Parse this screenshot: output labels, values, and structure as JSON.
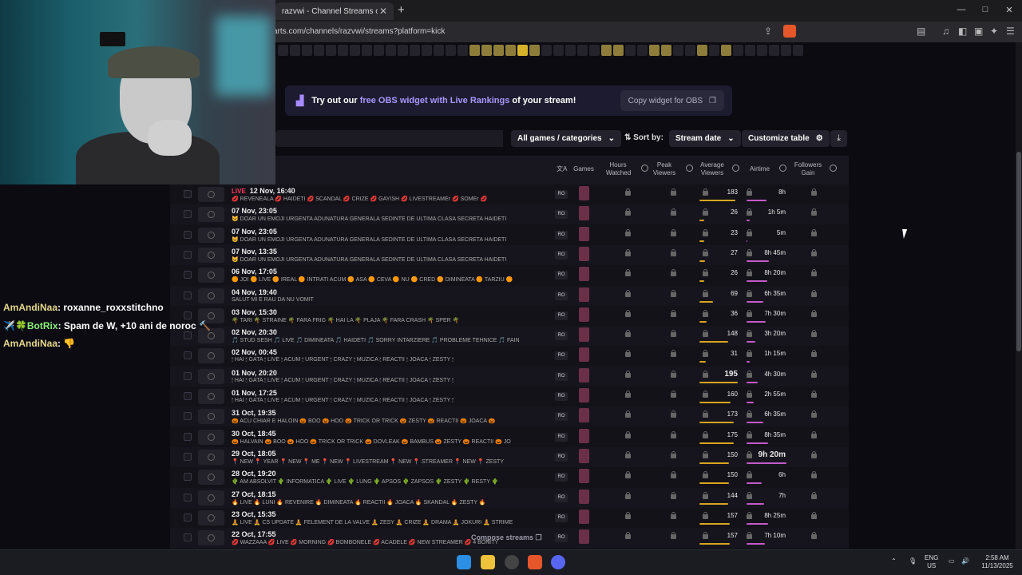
{
  "browser": {
    "tab_title": "razvwi - Channel Streams on Kick",
    "url": "arts.com/channels/razvwi/streams?platform=kick",
    "window_controls": [
      "—",
      "□",
      "✕"
    ]
  },
  "banner": {
    "prefix": "Try out our",
    "highlight": "free OBS widget with Live Rankings",
    "suffix": "of your stream!",
    "copy_label": "Copy widget for OBS"
  },
  "toolbar": {
    "games_filter": "All games / categories",
    "sort_label": "Sort by:",
    "sort_value": "Stream date",
    "customize_label": "Customize table"
  },
  "table": {
    "headers": {
      "stream": "e",
      "games": "Games",
      "hours_watched": "Hours Watched",
      "peak_viewers": "Peak Viewers",
      "average_viewers": "Average Viewers",
      "airtime": "Airtime",
      "followers_gain": "Followers Gain"
    },
    "live_badge": "LIVE",
    "rows": [
      {
        "date": "12 Nov, 16:40",
        "title": "💋 REVENEALA 💋 HAIDETI 💋 SCANDAL 💋 CRIZE 💋 GAYISH 💋 LIVESTREAMEr 💋 SOMEr 💋",
        "lang": "RO",
        "avg": "183",
        "avg_frac": 0.94,
        "airtime": "8h",
        "air_frac": 0.5,
        "live": true
      },
      {
        "date": "07 Nov, 23:05",
        "title": "😺 DOAR UN EMOJI URGENTA ADUNATURA GENERALA SEDINTE DE ULTIMA CLASA SECRETA HAIDETI",
        "lang": "RO",
        "avg": "26",
        "avg_frac": 0.13,
        "airtime": "1h 5m",
        "air_frac": 0.07
      },
      {
        "date": "07 Nov, 23:05",
        "title": "😺 DOAR UN EMOJI URGENTA ADUNATURA GENERALA SEDINTE DE ULTIMA CLASA SECRETA HAIDETI",
        "lang": "RO",
        "avg": "23",
        "avg_frac": 0.12,
        "airtime": "5m",
        "air_frac": 0.01
      },
      {
        "date": "07 Nov, 13:35",
        "title": "😺 DOAR UN EMOJI URGENTA ADUNATURA GENERALA SEDINTE DE ULTIMA CLASA SECRETA HAIDETI",
        "lang": "RO",
        "avg": "27",
        "avg_frac": 0.14,
        "airtime": "8h 45m",
        "air_frac": 0.55
      },
      {
        "date": "06 Nov, 17:05",
        "title": "🟠 JOI 🟠 LIVE 🟠 IREAL 🟠 INTRATI ACUM 🟠 ASA 🟠 CEVA 🟠 NU 🟠 CRED 🟠 DIMINEATA 🟠 TARZIU 🟠",
        "lang": "RO",
        "avg": "26",
        "avg_frac": 0.13,
        "airtime": "8h 20m",
        "air_frac": 0.52
      },
      {
        "date": "04 Nov, 19:40",
        "title": "SALUT MI E RAU DA NU VOMIT",
        "lang": "RO",
        "avg": "69",
        "avg_frac": 0.35,
        "airtime": "6h 35m",
        "air_frac": 0.41
      },
      {
        "date": "03 Nov, 15:30",
        "title": "🌴 TARI 🌴 STRAINE 🌴 FARA FRIG 🌴 HAI LA 🌴 PLAJA 🌴 FARA CRASH 🌴 SPER 🌴",
        "lang": "RO",
        "avg": "36",
        "avg_frac": 0.18,
        "airtime": "7h 30m",
        "air_frac": 0.47
      },
      {
        "date": "02 Nov, 20:30",
        "title": "🎵 STUD SESH 🎵 LIVE 🎵 DIMINEATA 🎵 HAIDETI 🎵 SORRY INTARZIERE 🎵 PROBLEME TEHNICE 🎵 FAIN",
        "lang": "RO",
        "avg": "148",
        "avg_frac": 0.76,
        "airtime": "3h 20m",
        "air_frac": 0.21
      },
      {
        "date": "02 Nov, 00:45",
        "title": "🕯 HAI 🕯 GATA 🕯 LIVE 🕯 ACUM 🕯 URGENT 🕯 CRAZY 🕯 MUZICA 🕯 REACTII 🕯 JOACA 🕯 ZESTY 🕯",
        "lang": "RO",
        "avg": "31",
        "avg_frac": 0.16,
        "airtime": "1h 15m",
        "air_frac": 0.08
      },
      {
        "date": "01 Nov, 20:20",
        "title": "🕯 HAI 🕯 GATA 🕯 LIVE 🕯 ACUM 🕯 URGENT 🕯 CRAZY 🕯 MUZICA 🕯 REACTII 🕯 JOACA 🕯 ZESTY 🕯",
        "lang": "RO",
        "avg": "195",
        "avg_frac": 1.0,
        "airtime": "4h 30m",
        "air_frac": 0.28,
        "avg_bold": true
      },
      {
        "date": "01 Nov, 17:25",
        "title": "🕯 HAI 🕯 GATA 🕯 LIVE 🕯 ACUM 🕯 URGENT 🕯 CRAZY 🕯 MUZICA 🕯 REACTII 🕯 JOACA 🕯 ZESTY 🕯",
        "lang": "RO",
        "avg": "160",
        "avg_frac": 0.82,
        "airtime": "2h 55m",
        "air_frac": 0.18
      },
      {
        "date": "31 Oct, 19:35",
        "title": "🎃 ACU CHIAR E HALOIN 🎃 BOO 🎃 HOO 🎃 TRICK OR TRICK 🎃 ZESTY 🎃 REACTII 🎃 JOACA 🎃",
        "lang": "RO",
        "avg": "173",
        "avg_frac": 0.89,
        "airtime": "6h 35m",
        "air_frac": 0.41
      },
      {
        "date": "30 Oct, 18:45",
        "title": "🎃 HALVAIN 🎃 BOO 🎃 HOO 🎃 TRICK OR TRICK 🎃 DOVLEAK 🎃 BAMBUS 🎃 ZESTY 🎃 REACTII 🎃 JO",
        "lang": "RO",
        "avg": "175",
        "avg_frac": 0.9,
        "airtime": "8h 35m",
        "air_frac": 0.54
      },
      {
        "date": "29 Oct, 18:05",
        "title": "📍 NEW 📍 YEAR 📍 NEW 📍 ME 📍 NEW 📍 LIVESTREAM 📍 NEW 📍 STREAMER 📍 NEW 📍 ZESTY",
        "lang": "RO",
        "avg": "150",
        "avg_frac": 0.77,
        "airtime": "9h 20m",
        "air_frac": 1.0,
        "air_bold": true
      },
      {
        "date": "28 Oct, 19:20",
        "title": "🌵 AM ABSOLVIT 🌵 INFORMATICA 🌵 LIVE 🌵 LUNG 🌵 APSOS 🌵 ZAPSOS 🌵 ZESTY 🌵 RESTY 🌵",
        "lang": "RO",
        "avg": "150",
        "avg_frac": 0.77,
        "airtime": "6h",
        "air_frac": 0.38
      },
      {
        "date": "27 Oct, 18:15",
        "title": "🔥 LIVE 🔥 LUNI 🔥 REVENIRE 🔥 DIMINEATA 🔥 REACTII 🔥 JOACA 🔥 SKANDAL 🔥 ZESTY 🔥",
        "lang": "RO",
        "avg": "144",
        "avg_frac": 0.74,
        "airtime": "7h",
        "air_frac": 0.44
      },
      {
        "date": "23 Oct, 15:35",
        "title": "🧘 LIVE 🧘 CS UPDATE 🧘 FELEMENT DE LA VALVE 🧘 ZESY 🧘 CRIZE 🧘 DRAMA 🧘 JOKURI 🧘 STRIME",
        "lang": "RO",
        "avg": "157",
        "avg_frac": 0.8,
        "airtime": "8h 25m",
        "air_frac": 0.53
      },
      {
        "date": "22 Oct, 17:55",
        "title": "💋 WAZZAAA 💋 LIVE 💋 MORNING 💋 BOMBONELE 💋 ACADELE 💋 NEW STREAMER 💋 4 BONITY",
        "lang": "RO",
        "avg": "157",
        "avg_frac": 0.8,
        "airtime": "7h 10m",
        "air_frac": 0.45
      }
    ],
    "compose_label": "Compose streams"
  },
  "chat": [
    {
      "user": "AmAndiNaa",
      "text": "roxanne_roxxstitchno"
    },
    {
      "user": "BotRix",
      "badge": "✈️🍀",
      "text": "Spam de W, +10 ani de noroc 🔨"
    },
    {
      "user": "AmAndiNaa",
      "text": "👎"
    }
  ],
  "taskbar": {
    "lang_top": "ENG",
    "lang_bottom": "US",
    "time": "2:58 AM",
    "date": "11/13/2025"
  },
  "colors": {
    "accent_purple": "#a997ff",
    "avg_bar": "#d9a51f",
    "airtime_bar": "#c45ac9",
    "live_red": "#ff3b5c"
  }
}
